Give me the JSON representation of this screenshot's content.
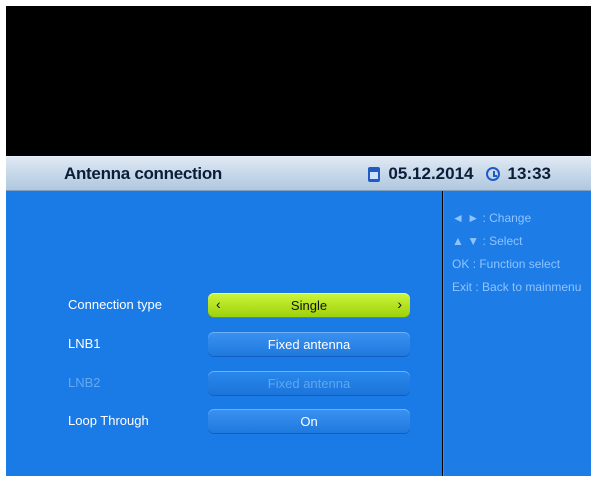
{
  "header": {
    "title": "Antenna connection",
    "date": "05.12.2014",
    "time": "13:33",
    "date_icon": "calendar-icon",
    "time_icon": "clock-icon"
  },
  "help": [
    {
      "key": "◄ ►",
      "text": ": Change"
    },
    {
      "key": "▲ ▼",
      "text": ": Select"
    },
    {
      "key": "OK",
      "text": ": Function select"
    },
    {
      "key": "Exit",
      "text": ": Back to mainmenu"
    }
  ],
  "rows": [
    {
      "label": "Connection type",
      "value": "Single",
      "state": "selected",
      "left_arrow": "‹",
      "right_arrow": "›"
    },
    {
      "label": "LNB1",
      "value": "Fixed antenna",
      "state": "normal"
    },
    {
      "label": "LNB2",
      "value": "Fixed antenna",
      "state": "disabled"
    },
    {
      "label": "Loop Through",
      "value": "On",
      "state": "normal"
    }
  ],
  "colors": {
    "panel_blue": "#1a7ae6",
    "selected_green": "#b6e322",
    "header_bg": "#c2d5e8"
  }
}
